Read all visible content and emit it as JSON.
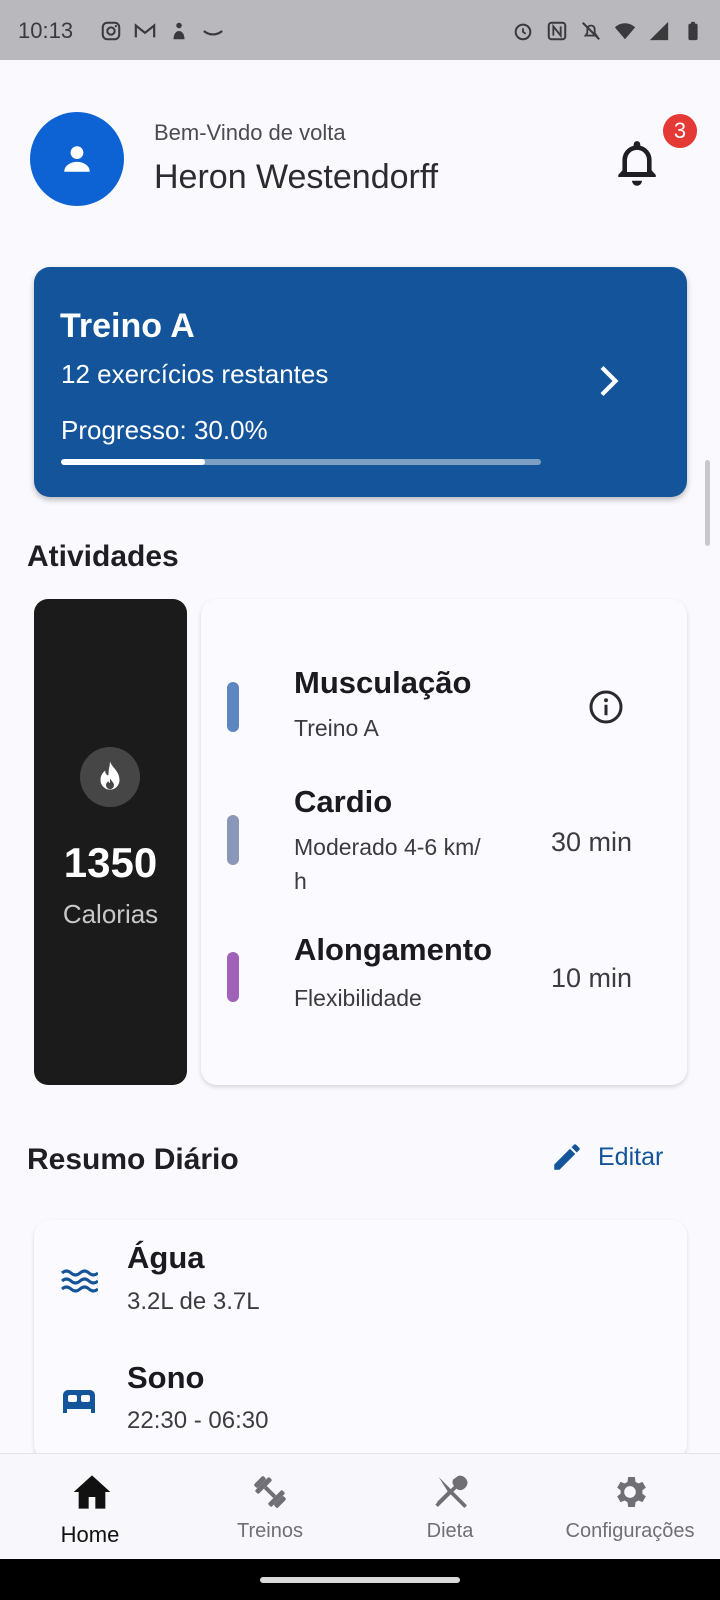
{
  "status_bar": {
    "time": "10:13",
    "left_icons": [
      "instagram-icon",
      "gmail-icon",
      "app-icon",
      "amazon-icon"
    ],
    "right_icons": [
      "alarm-icon",
      "nfc-icon",
      "mute-icon",
      "wifi-icon",
      "signal-icon",
      "battery-icon"
    ]
  },
  "header": {
    "welcome": "Bem-Vindo de volta",
    "user_name": "Heron Westendorff",
    "notification_count": "3"
  },
  "workout_card": {
    "title": "Treino A",
    "subtitle": "12 exercícios restantes",
    "progress_label": "Progresso: 30.0%",
    "progress_fraction": 0.3
  },
  "activities": {
    "title": "Atividades",
    "calories_value": "1350",
    "calories_label": "Calorias",
    "items": [
      {
        "name": "Musculação",
        "desc": "Treino A",
        "duration": "",
        "color": "#5b86bf"
      },
      {
        "name": "Cardio",
        "desc": "Moderado  4-6 km/\nh",
        "duration": "30 min",
        "color": "#8a97b8"
      },
      {
        "name": "Alongamento",
        "desc": "Flexibilidade",
        "duration": "10 min",
        "color": "#9f62b8"
      }
    ]
  },
  "daily_summary": {
    "title": "Resumo Diário",
    "edit_label": "Editar",
    "items": [
      {
        "title": "Água",
        "value": "3.2L de 3.7L",
        "icon": "water-icon"
      },
      {
        "title": "Sono",
        "value": "22:30 - 06:30",
        "icon": "bed-icon"
      }
    ]
  },
  "bottom_nav": {
    "items": [
      {
        "label": "Home",
        "icon": "home-icon",
        "active": true
      },
      {
        "label": "Treinos",
        "icon": "dumbbell-icon",
        "active": false
      },
      {
        "label": "Dieta",
        "icon": "utensils-icon",
        "active": false
      },
      {
        "label": "Configurações",
        "icon": "gear-icon",
        "active": false
      }
    ]
  },
  "colors": {
    "primary": "#13549a",
    "avatar": "#0d63d3",
    "badge": "#e53935",
    "calorie_card": "#1b1b1b"
  }
}
